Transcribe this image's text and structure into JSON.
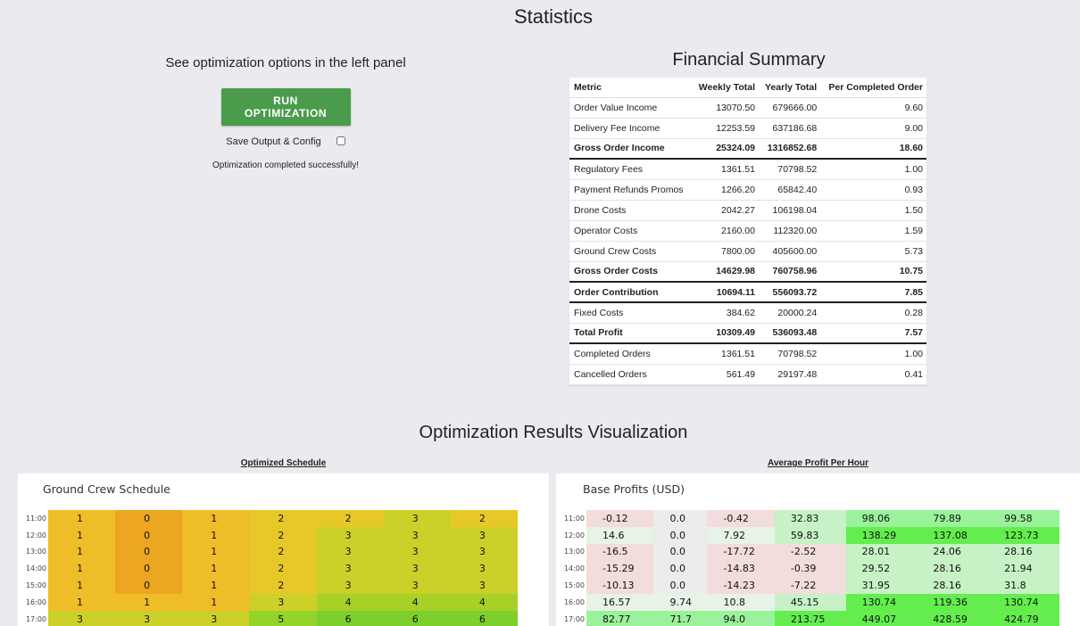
{
  "page": {
    "title": "Statistics"
  },
  "left_panel": {
    "heading": "See optimization options in the left panel",
    "run_button": "RUN OPTIMIZATION",
    "save_label": "Save Output & Config",
    "status": "Optimization completed successfully!"
  },
  "financial_summary": {
    "title": "Financial Summary",
    "columns": [
      "Metric",
      "Weekly Total",
      "Yearly Total",
      "Per Completed Order"
    ],
    "rows": [
      {
        "cells": [
          "Order Value Income",
          "13070.50",
          "679666.00",
          "9.60"
        ],
        "bold": false
      },
      {
        "cells": [
          "Delivery Fee Income",
          "12253.59",
          "637186.68",
          "9.00"
        ],
        "bold": false
      },
      {
        "cells": [
          "Gross Order Income",
          "25324.09",
          "1316852.68",
          "18.60"
        ],
        "bold": true
      },
      {
        "cells": [
          "Regulatory Fees",
          "1361.51",
          "70798.52",
          "1.00"
        ],
        "bold": false
      },
      {
        "cells": [
          "Payment Refunds Promos",
          "1266.20",
          "65842.40",
          "0.93"
        ],
        "bold": false
      },
      {
        "cells": [
          "Drone Costs",
          "2042.27",
          "106198.04",
          "1.50"
        ],
        "bold": false
      },
      {
        "cells": [
          "Operator Costs",
          "2160.00",
          "112320.00",
          "1.59"
        ],
        "bold": false
      },
      {
        "cells": [
          "Ground Crew Costs",
          "7800.00",
          "405600.00",
          "5.73"
        ],
        "bold": false
      },
      {
        "cells": [
          "Gross Order Costs",
          "14629.98",
          "760758.96",
          "10.75"
        ],
        "bold": true
      },
      {
        "cells": [
          "Order Contribution",
          "10694.11",
          "556093.72",
          "7.85"
        ],
        "bold": true
      },
      {
        "cells": [
          "Fixed Costs",
          "384.62",
          "20000.24",
          "0.28"
        ],
        "bold": false
      },
      {
        "cells": [
          "Total Profit",
          "10309.49",
          "536093.48",
          "7.57"
        ],
        "bold": true
      },
      {
        "cells": [
          "Completed Orders",
          "1361.51",
          "70798.52",
          "1.00"
        ],
        "bold": false
      },
      {
        "cells": [
          "Cancelled Orders",
          "561.49",
          "29197.48",
          "0.41"
        ],
        "bold": false
      }
    ]
  },
  "visualization": {
    "title": "Optimization Results Visualization",
    "schedule": {
      "label": "Optimized Schedule",
      "title": "Ground Crew Schedule",
      "times": [
        "11:00",
        "12:00",
        "13:00",
        "14:00",
        "15:00",
        "16:00",
        "17:00"
      ],
      "rows": [
        [
          "1",
          "0",
          "1",
          "2",
          "2",
          "3",
          "2"
        ],
        [
          "1",
          "0",
          "1",
          "2",
          "3",
          "3",
          "3"
        ],
        [
          "1",
          "0",
          "1",
          "2",
          "3",
          "3",
          "3"
        ],
        [
          "1",
          "0",
          "1",
          "2",
          "3",
          "3",
          "3"
        ],
        [
          "1",
          "0",
          "1",
          "2",
          "3",
          "3",
          "3"
        ],
        [
          "1",
          "1",
          "1",
          "3",
          "4",
          "4",
          "4"
        ],
        [
          "3",
          "3",
          "3",
          "5",
          "6",
          "6",
          "6"
        ]
      ],
      "colors": {
        "0": "#eda621",
        "1": "#efbd27",
        "2": "#e8c828",
        "3": "#cdd028",
        "4": "#a7d128",
        "5": "#93d32a",
        "6": "#7dcf2b"
      }
    },
    "profits": {
      "label": "Average Profit Per Hour",
      "title": "Base Profits (USD)",
      "times": [
        "11:00",
        "12:00",
        "13:00",
        "14:00",
        "15:00",
        "16:00",
        "17:00"
      ],
      "rows": [
        [
          "-0.12",
          "0.0",
          "-0.42",
          "32.83",
          "98.06",
          "79.89",
          "99.58"
        ],
        [
          "14.6",
          "0.0",
          "7.92",
          "59.83",
          "138.29",
          "137.08",
          "123.73"
        ],
        [
          "-16.5",
          "0.0",
          "-17.72",
          "-2.52",
          "28.01",
          "24.06",
          "28.16"
        ],
        [
          "-15.29",
          "0.0",
          "-14.83",
          "-0.39",
          "29.52",
          "28.16",
          "21.94"
        ],
        [
          "-10.13",
          "0.0",
          "-14.23",
          "-7.22",
          "31.95",
          "28.16",
          "31.8"
        ],
        [
          "16.57",
          "9.74",
          "10.8",
          "45.15",
          "130.74",
          "119.36",
          "130.74"
        ],
        [
          "82.77",
          "71.7",
          "94.0",
          "213.75",
          "449.07",
          "428.59",
          "424.79"
        ]
      ],
      "colors": {
        "negative": "#f2dcdc",
        "zero": "#ececec",
        "positive_low": "#e6f3e6",
        "positive_mid": "#c6f2c6",
        "positive_high": "#9af29a",
        "positive_max": "#63ee4e"
      }
    }
  }
}
